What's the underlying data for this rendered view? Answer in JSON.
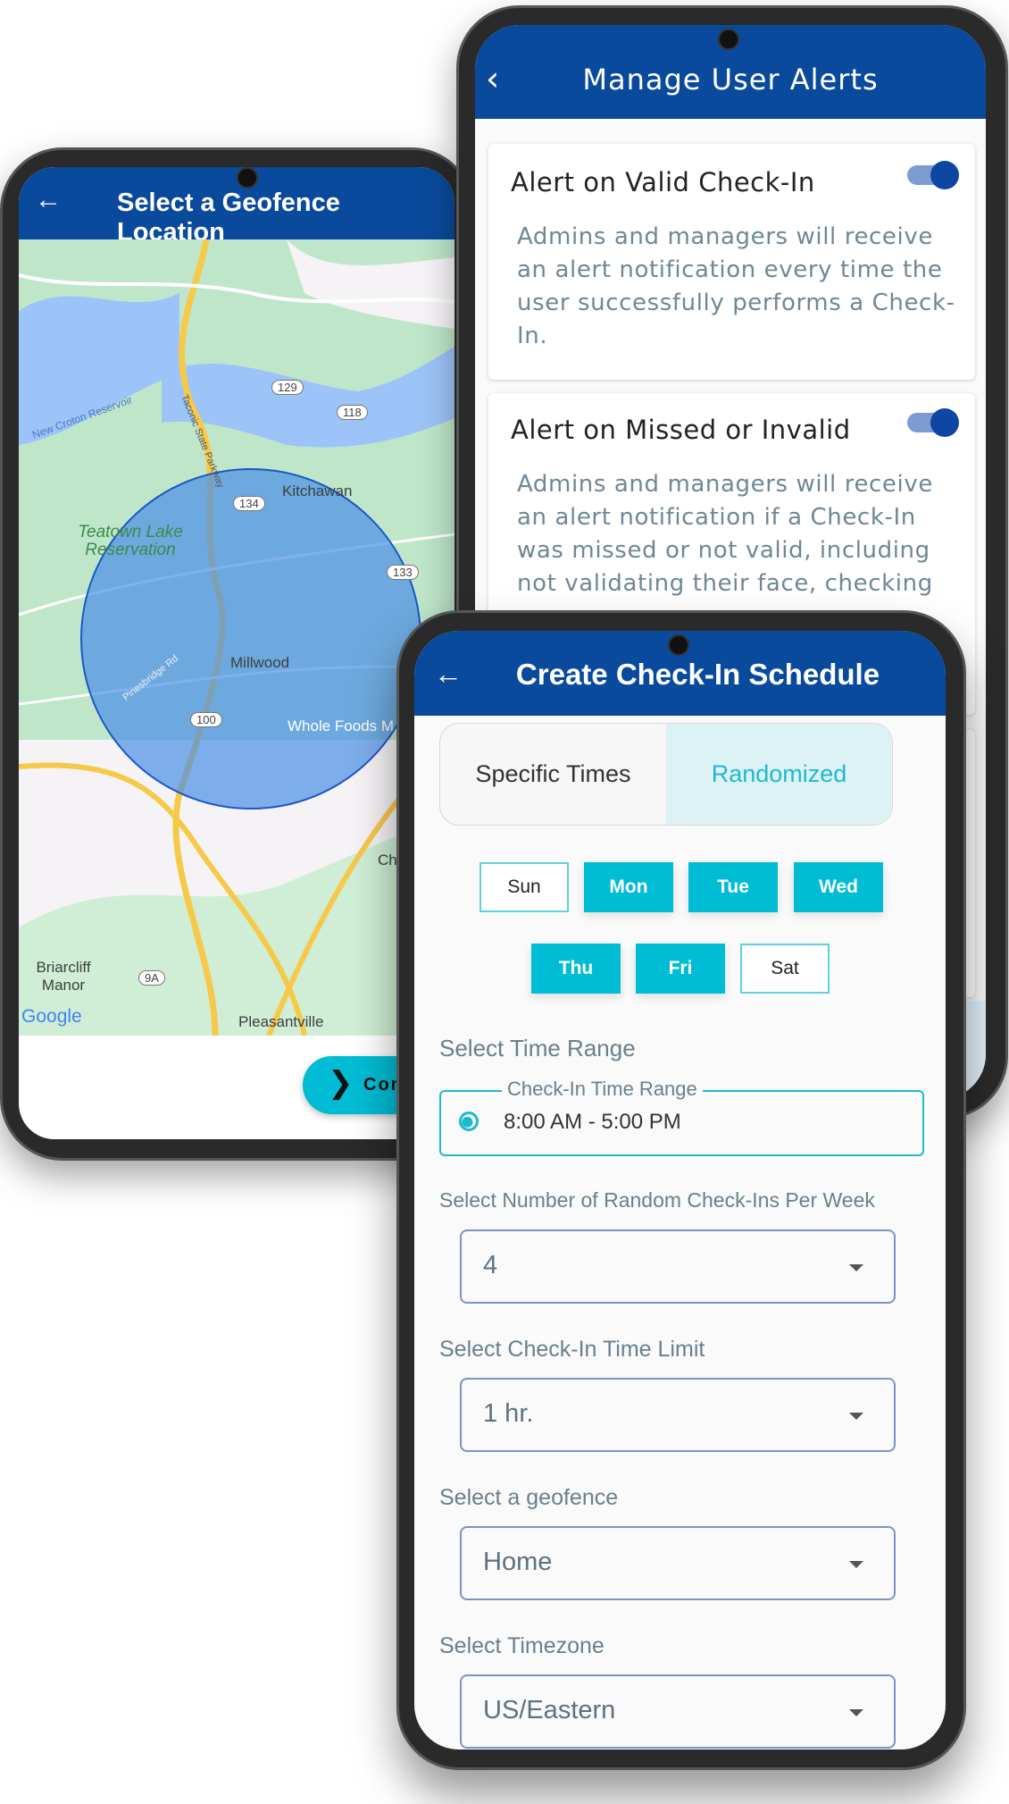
{
  "geofence_screen": {
    "title": "Select a Geofence Location",
    "continue_button": "Con",
    "map": {
      "labels": {
        "reservoir": "New Croton Reservoir",
        "parkway": "Taconic State Parkway",
        "kitchawan": "Kitchawan",
        "teatown": "Teatown Lake Reservation",
        "millwood": "Millwood",
        "pinesbridge": "Pinesbridge Rd",
        "whole_foods": "Whole Foods M",
        "ch": "Ch",
        "briarcliff": "Briarcliff Manor",
        "pleasantville": "Pleasantville",
        "google": "Google"
      },
      "route_shields": [
        "129",
        "118",
        "134",
        "133",
        "100",
        "9A"
      ],
      "geofence_color": "#4a8fe7"
    }
  },
  "alerts_screen": {
    "title": "Manage User Alerts",
    "cards": [
      {
        "title": "Alert on Valid Check-In",
        "enabled": true,
        "body": "Admins and managers will receive an alert notification every time the user successfully performs a Check-In."
      },
      {
        "title": "Alert on Missed or Invalid",
        "enabled": true,
        "body": "Admins and managers will receive an alert notification if a Check-In was missed or not valid, including not validating their face, checking"
      }
    ]
  },
  "schedule_screen": {
    "title": "Create Check-In Schedule",
    "modes": [
      {
        "label": "Specific Times",
        "selected": false
      },
      {
        "label": "Randomized",
        "selected": true
      }
    ],
    "days": [
      {
        "label": "Sun",
        "selected": false
      },
      {
        "label": "Mon",
        "selected": true
      },
      {
        "label": "Tue",
        "selected": true
      },
      {
        "label": "Wed",
        "selected": true
      },
      {
        "label": "Thu",
        "selected": true
      },
      {
        "label": "Fri",
        "selected": true
      },
      {
        "label": "Sat",
        "selected": false
      }
    ],
    "time_range_label": "Select Time Range",
    "time_range_field_label": "Check-In Time Range",
    "time_range_value": "8:00 AM - 5:00 PM",
    "random_checkins_label": "Select Number of Random Check-Ins Per Week",
    "random_checkins_value": "4",
    "time_limit_label": "Select Check-In Time Limit",
    "time_limit_value": "1 hr.",
    "geofence_label": "Select a geofence",
    "geofence_value": "Home",
    "timezone_label": "Select Timezone",
    "timezone_value": "US/Eastern"
  },
  "colors": {
    "header": "#0a4a9c",
    "accent": "#00bcd4",
    "toggle": "#0d47a1"
  }
}
